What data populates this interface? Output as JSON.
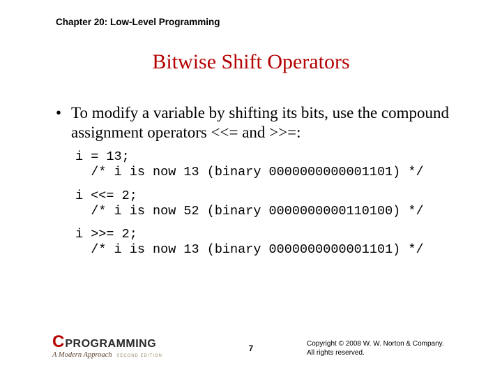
{
  "chapter": "Chapter 20: Low-Level Programming",
  "title": "Bitwise Shift Operators",
  "bullet_text": "To modify a variable by shifting its bits, use the compound assignment operators <<= and >>=:",
  "code_blocks": [
    "i = 13;\n  /* i is now 13 (binary 0000000000001101) */",
    "i <<= 2;\n  /* i is now 52 (binary 0000000000110100) */",
    "i >>= 2;\n  /* i is now 13 (binary 0000000000001101) */"
  ],
  "logo": {
    "c": "C",
    "prog": "PROGRAMMING",
    "sub": "A Modern Approach",
    "edition": "SECOND EDITION"
  },
  "page_number": "7",
  "copyright_line1": "Copyright © 2008 W. W. Norton & Company.",
  "copyright_line2": "All rights reserved."
}
